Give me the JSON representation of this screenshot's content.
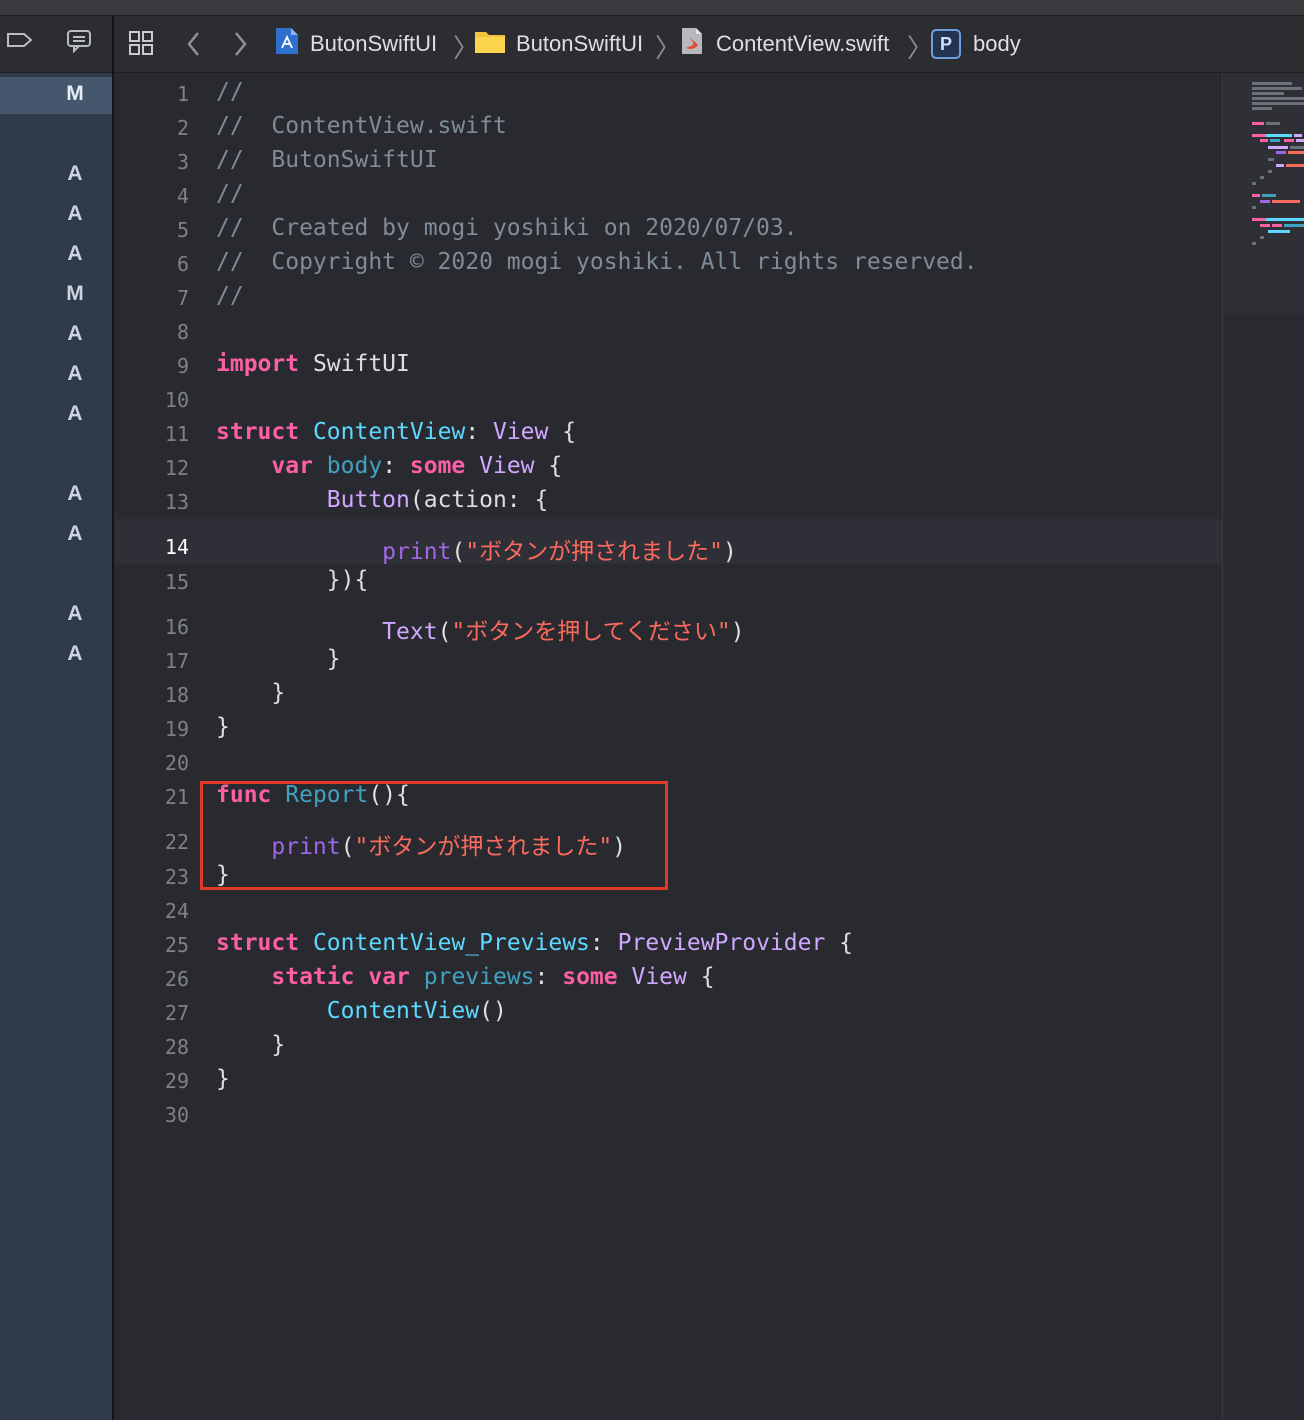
{
  "breadcrumb": {
    "project": "ButonSwiftUI",
    "folder": "ButonSwiftUI",
    "file": "ContentView.swift",
    "symbol_badge": "P",
    "symbol": "body"
  },
  "source_control_markers": [
    {
      "line": "1",
      "status": "M"
    },
    {
      "line": "3",
      "status": "A"
    },
    {
      "line": "4",
      "status": "A"
    },
    {
      "line": "5",
      "status": "A"
    },
    {
      "line": "6",
      "status": "M"
    },
    {
      "line": "7",
      "status": "A"
    },
    {
      "line": "8",
      "status": "A"
    },
    {
      "line": "9",
      "status": "A"
    },
    {
      "line": "11",
      "status": "A"
    },
    {
      "line": "12",
      "status": "A"
    },
    {
      "line": "14",
      "status": "A"
    },
    {
      "line": "15",
      "status": "A"
    }
  ],
  "editor": {
    "current_line": "14",
    "line_numbers": [
      "1",
      "2",
      "3",
      "4",
      "5",
      "6",
      "7",
      "8",
      "9",
      "10",
      "11",
      "12",
      "13",
      "14",
      "15",
      "16",
      "17",
      "18",
      "19",
      "20",
      "21",
      "22",
      "23",
      "24",
      "25",
      "26",
      "27",
      "28",
      "29",
      "30"
    ],
    "lines": [
      [
        {
          "t": "//",
          "c": "cm"
        }
      ],
      [
        {
          "t": "//  ContentView.swift",
          "c": "cm"
        }
      ],
      [
        {
          "t": "//  ButonSwiftUI",
          "c": "cm"
        }
      ],
      [
        {
          "t": "//",
          "c": "cm"
        }
      ],
      [
        {
          "t": "//  Created by mogi yoshiki on 2020/07/03.",
          "c": "cm"
        }
      ],
      [
        {
          "t": "//  Copyright © 2020 mogi yoshiki. All rights reserved.",
          "c": "cm"
        }
      ],
      [
        {
          "t": "//",
          "c": "cm"
        }
      ],
      [],
      [
        {
          "t": "import",
          "c": "kw"
        },
        {
          "t": " SwiftUI",
          "c": "tx"
        }
      ],
      [],
      [
        {
          "t": "struct",
          "c": "kw"
        },
        {
          "t": " ",
          "c": "tx"
        },
        {
          "t": "ContentView",
          "c": "ty"
        },
        {
          "t": ": ",
          "c": "tx"
        },
        {
          "t": "View",
          "c": "tp"
        },
        {
          "t": " {",
          "c": "tx"
        }
      ],
      [
        {
          "t": "    ",
          "c": "tx"
        },
        {
          "t": "var",
          "c": "kw"
        },
        {
          "t": " ",
          "c": "tx"
        },
        {
          "t": "body",
          "c": "pr"
        },
        {
          "t": ": ",
          "c": "tx"
        },
        {
          "t": "some",
          "c": "kw"
        },
        {
          "t": " ",
          "c": "tx"
        },
        {
          "t": "View",
          "c": "tp"
        },
        {
          "t": " {",
          "c": "tx"
        }
      ],
      [
        {
          "t": "        ",
          "c": "tx"
        },
        {
          "t": "Button",
          "c": "tp"
        },
        {
          "t": "(action: {",
          "c": "tx"
        }
      ],
      [
        {
          "t": "            ",
          "c": "tx"
        },
        {
          "t": "print",
          "c": "fn"
        },
        {
          "t": "(",
          "c": "tx"
        },
        {
          "t": "\"ボタンが押されました\"",
          "c": "st"
        },
        {
          "t": ")",
          "c": "tx"
        }
      ],
      [
        {
          "t": "        }){",
          "c": "tx"
        }
      ],
      [
        {
          "t": "            ",
          "c": "tx"
        },
        {
          "t": "Text",
          "c": "tp"
        },
        {
          "t": "(",
          "c": "tx"
        },
        {
          "t": "\"ボタンを押してください\"",
          "c": "st"
        },
        {
          "t": ")",
          "c": "tx"
        }
      ],
      [
        {
          "t": "        }",
          "c": "tx"
        }
      ],
      [
        {
          "t": "    }",
          "c": "tx"
        }
      ],
      [
        {
          "t": "}",
          "c": "tx"
        }
      ],
      [],
      [
        {
          "t": "func",
          "c": "kw"
        },
        {
          "t": " ",
          "c": "tx"
        },
        {
          "t": "Report",
          "c": "pr"
        },
        {
          "t": "(){",
          "c": "tx"
        }
      ],
      [
        {
          "t": "    ",
          "c": "tx"
        },
        {
          "t": "print",
          "c": "fn"
        },
        {
          "t": "(",
          "c": "tx"
        },
        {
          "t": "\"ボタンが押されました\"",
          "c": "st"
        },
        {
          "t": ")",
          "c": "tx"
        }
      ],
      [
        {
          "t": "}",
          "c": "tx"
        }
      ],
      [],
      [
        {
          "t": "struct",
          "c": "kw"
        },
        {
          "t": " ",
          "c": "tx"
        },
        {
          "t": "ContentView_Previews",
          "c": "ty"
        },
        {
          "t": ": ",
          "c": "tx"
        },
        {
          "t": "PreviewProvider",
          "c": "tp"
        },
        {
          "t": " {",
          "c": "tx"
        }
      ],
      [
        {
          "t": "    ",
          "c": "tx"
        },
        {
          "t": "static",
          "c": "kw"
        },
        {
          "t": " ",
          "c": "tx"
        },
        {
          "t": "var",
          "c": "kw"
        },
        {
          "t": " ",
          "c": "tx"
        },
        {
          "t": "previews",
          "c": "pr"
        },
        {
          "t": ": ",
          "c": "tx"
        },
        {
          "t": "some",
          "c": "kw"
        },
        {
          "t": " ",
          "c": "tx"
        },
        {
          "t": "View",
          "c": "tp"
        },
        {
          "t": " {",
          "c": "tx"
        }
      ],
      [
        {
          "t": "        ",
          "c": "tx"
        },
        {
          "t": "ContentView",
          "c": "ty"
        },
        {
          "t": "()",
          "c": "tx"
        }
      ],
      [
        {
          "t": "    }",
          "c": "tx"
        }
      ],
      [
        {
          "t": "}",
          "c": "tx"
        }
      ],
      []
    ]
  },
  "colors": {
    "keyword": "#fc5fa3",
    "comment": "#7f8c98",
    "type_decl": "#5dd8ff",
    "type_ref": "#d0a8ff",
    "property": "#41a1c0",
    "function": "#a167e6",
    "string": "#fc6a5d",
    "annotation_box": "#e23a2a"
  },
  "icons": [
    "label-icon",
    "comment-icon",
    "related-items-grid-icon",
    "back-chevron-icon",
    "forward-chevron-icon",
    "xcode-project-icon",
    "folder-icon",
    "swift-file-icon"
  ]
}
